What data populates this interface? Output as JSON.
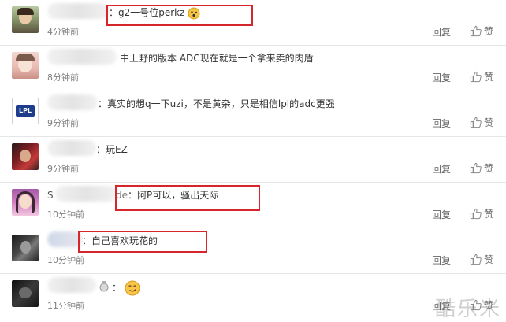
{
  "comments": [
    {
      "text": "：g2一号位perkz",
      "time": "4分钟前",
      "emoji": "wink-emoji"
    },
    {
      "text": "中上野的版本 ADC现在就是一个拿来卖的肉盾",
      "time": "8分钟前"
    },
    {
      "text": "：真实的想q一下uzi，不是黄杂，只是相信lpl的adc更强",
      "time": "9分钟前",
      "avatar_text": "LPL"
    },
    {
      "text": "：玩EZ",
      "time": "9分钟前"
    },
    {
      "name_fragment": "S",
      "name_suffix": "de",
      "text": "：阿P可以，骚出天际",
      "time": "10分钟前"
    },
    {
      "text": "：自己喜欢玩花的",
      "time": "10分钟前"
    },
    {
      "text": "：",
      "time": "11分钟前",
      "emoji": "smirk-emoji"
    }
  ],
  "actions": {
    "reply": "回复",
    "like": "赞"
  },
  "watermark": "酷乐米",
  "colors": {
    "highlight": "#d7262b",
    "time": "#808080",
    "divider": "#e6e6e6"
  }
}
